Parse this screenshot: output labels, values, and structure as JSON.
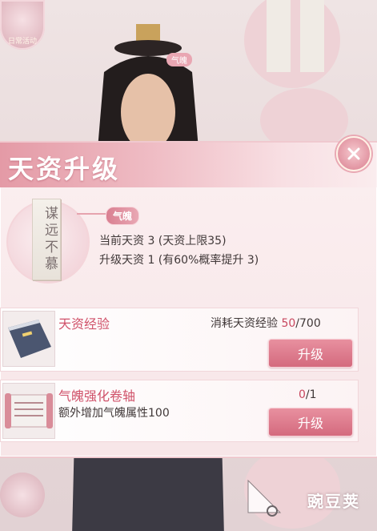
{
  "background": {
    "top_badge_label": "日常活动",
    "small_tag": "气魄"
  },
  "panel": {
    "title": "天资升级",
    "medallion_text": "谋远不慕",
    "attribute_tag": "气魄",
    "current_line": "当前天资 3 (天资上限35)",
    "upgrade_line": "升级天资 1 (有60%概率提升 3)"
  },
  "items": [
    {
      "title": "天资经验",
      "icon": "book-icon",
      "cost_label": "消耗天资经验",
      "cost_current": "50",
      "cost_max": "/700",
      "button": "升级"
    },
    {
      "title": "气魄强化卷轴",
      "icon": "scroll-icon",
      "description": "额外增加气魄属性100",
      "count_current": "0",
      "count_max": "/1",
      "button": "升级"
    }
  ],
  "watermark": "豌豆荚",
  "colors": {
    "accent": "#d46a7e",
    "title_red": "#d0526a",
    "panel_bg": "#fbeff0"
  }
}
